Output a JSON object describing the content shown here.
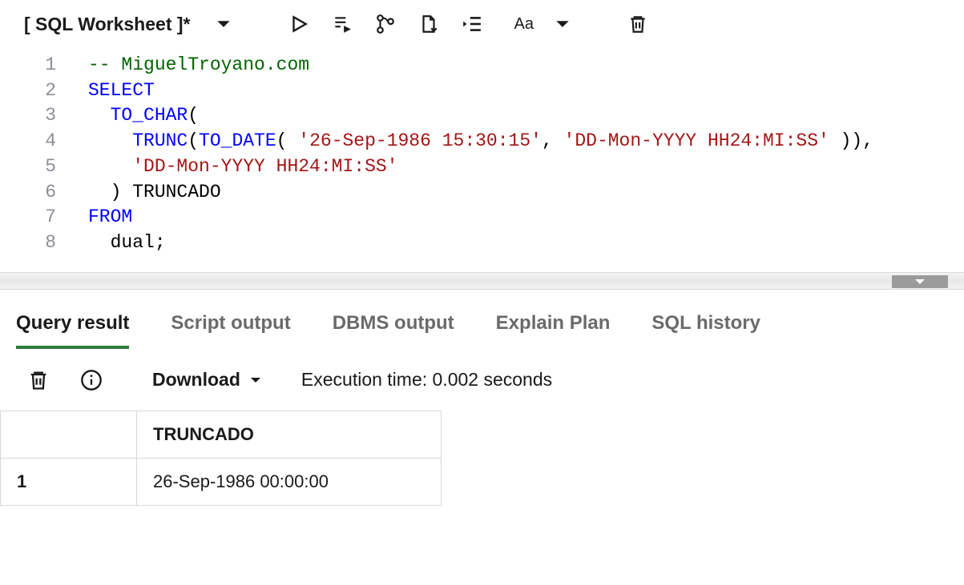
{
  "toolbar": {
    "worksheet_title": "[ SQL Worksheet ]*",
    "font_label": "Aa",
    "icons": {
      "dropdown": "chevron-down",
      "run": "play",
      "run_script": "run-script",
      "explain": "explain-plan",
      "save": "save-download",
      "format": "indent",
      "font": "font-size",
      "trash": "trash"
    }
  },
  "editor": {
    "lines": [
      {
        "n": 1,
        "tokens": [
          [
            "comment",
            "-- MiguelTroyano.com"
          ]
        ]
      },
      {
        "n": 2,
        "tokens": [
          [
            "kw",
            "SELECT"
          ]
        ]
      },
      {
        "n": 3,
        "guide": 1,
        "tokens": [
          [
            "sp",
            "  "
          ],
          [
            "func",
            "TO_CHAR"
          ],
          [
            "punct",
            "("
          ]
        ]
      },
      {
        "n": 4,
        "guide": 1,
        "tokens": [
          [
            "sp",
            "    "
          ],
          [
            "func",
            "TRUNC"
          ],
          [
            "punct",
            "("
          ],
          [
            "func",
            "TO_DATE"
          ],
          [
            "punct",
            "( "
          ],
          [
            "str",
            "'26-Sep-1986 15:30:15'"
          ],
          [
            "punct",
            ", "
          ],
          [
            "str",
            "'DD-Mon-YYYY HH24:MI:SS'"
          ],
          [
            "punct",
            " )),"
          ]
        ]
      },
      {
        "n": 5,
        "guide": 1,
        "tokens": [
          [
            "sp",
            "    "
          ],
          [
            "str",
            "'DD-Mon-YYYY HH24:MI:SS'"
          ]
        ]
      },
      {
        "n": 6,
        "guide": 1,
        "tokens": [
          [
            "sp",
            "  "
          ],
          [
            "punct",
            ")"
          ],
          [
            "ident",
            " TRUNCADO"
          ]
        ]
      },
      {
        "n": 7,
        "tokens": [
          [
            "kw",
            "FROM"
          ]
        ]
      },
      {
        "n": 8,
        "guide": 1,
        "tokens": [
          [
            "sp",
            "  "
          ],
          [
            "ident",
            "dual"
          ],
          [
            "punct",
            ";"
          ]
        ]
      }
    ]
  },
  "tabs": {
    "items": [
      {
        "label": "Query result",
        "active": true
      },
      {
        "label": "Script output",
        "active": false
      },
      {
        "label": "DBMS output",
        "active": false
      },
      {
        "label": "Explain Plan",
        "active": false
      },
      {
        "label": "SQL history",
        "active": false
      }
    ]
  },
  "result_toolbar": {
    "download_label": "Download",
    "exec_time_label": "Execution time: 0.002 seconds"
  },
  "result_table": {
    "columns": [
      "TRUNCADO"
    ],
    "rows": [
      {
        "n": "1",
        "cells": [
          "26-Sep-1986 00:00:00"
        ]
      }
    ]
  }
}
